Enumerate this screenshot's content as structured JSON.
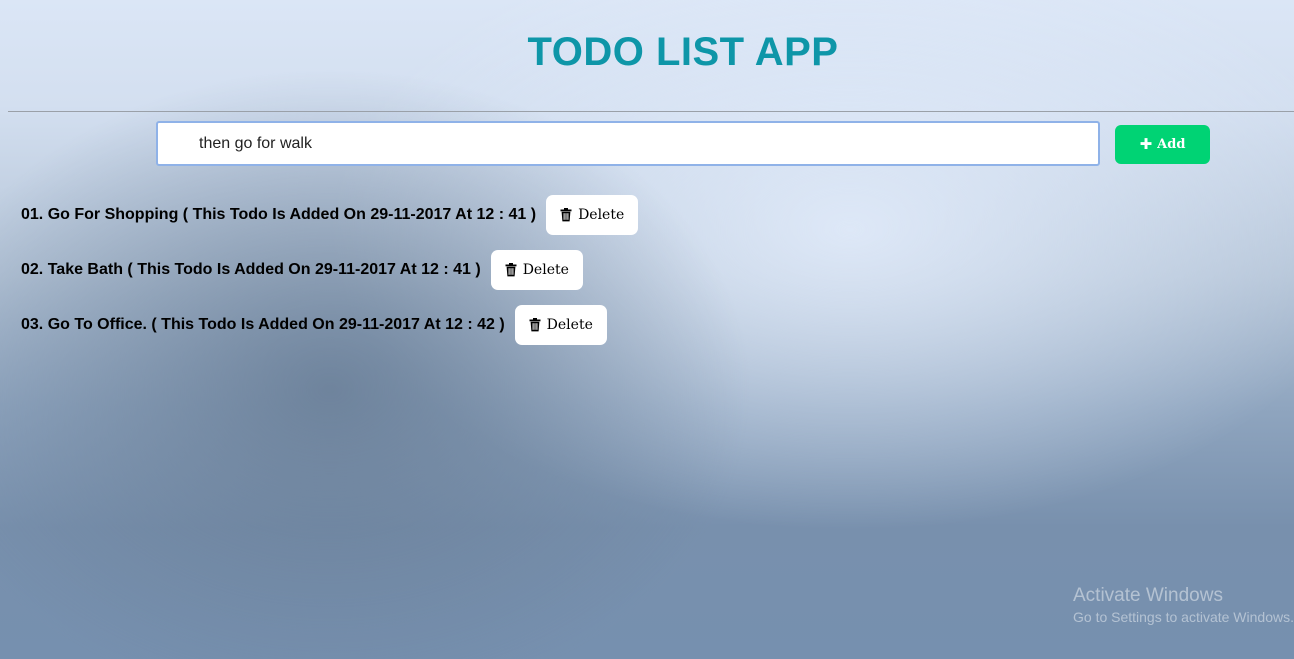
{
  "app": {
    "title": "TODO LIST APP"
  },
  "input": {
    "value": "then go for walk",
    "placeholder": ""
  },
  "add_button": {
    "label": "Add",
    "icon": "plus-icon"
  },
  "todos": [
    {
      "number": "01.",
      "text": "Go For Shopping ( This Todo Is Added On 29-11-2017 At 12 : 41 )",
      "delete_label": "Delete"
    },
    {
      "number": "02.",
      "text": "Take Bath ( This Todo Is Added On 29-11-2017 At 12 : 41 )",
      "delete_label": "Delete"
    },
    {
      "number": "03.",
      "text": "Go To Office. ( This Todo Is Added On 29-11-2017 At 12 : 42 )",
      "delete_label": "Delete"
    }
  ],
  "delete_icon": "trash-icon",
  "watermark": {
    "title": "Activate Windows",
    "subtitle": "Go to Settings to activate Windows."
  },
  "colors": {
    "title": "#0e96a8",
    "add_button": "#00d374",
    "input_border": "#8fb2e8"
  }
}
